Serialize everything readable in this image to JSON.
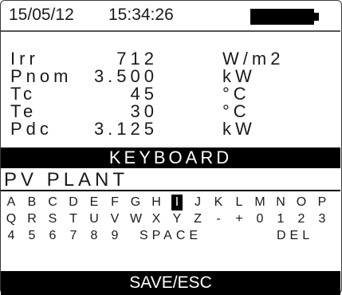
{
  "status_bar": {
    "date": "15/05/12",
    "time": "15:34:26",
    "battery_icon": "battery-full-icon"
  },
  "readings": [
    {
      "label": "Irr",
      "value": "712",
      "unit": "W/m2"
    },
    {
      "label": "Pnom",
      "value": "3.500",
      "unit": "kW"
    },
    {
      "label": "Tc",
      "value": "45",
      "unit": "°C"
    },
    {
      "label": "Te",
      "value": "30",
      "unit": "°C"
    },
    {
      "label": "Pdc",
      "value": "3.125",
      "unit": "kW"
    }
  ],
  "keyboard": {
    "title": "KEYBOARD",
    "field_value": "PV PLANT",
    "rows": [
      [
        "A",
        "B",
        "C",
        "D",
        "E",
        "F",
        "G",
        "H",
        "I",
        "J",
        "K",
        "L",
        "M",
        "N",
        "O",
        "P"
      ],
      [
        "Q",
        "R",
        "S",
        "T",
        "U",
        "V",
        "W",
        "X",
        "Y",
        "Z",
        "-",
        "+",
        "0",
        "1",
        "2",
        "3"
      ],
      [
        "4",
        "5",
        "6",
        "7",
        "8",
        "9",
        "SPACE",
        "DEL"
      ]
    ],
    "selected_key": "I"
  },
  "footer": {
    "save_label": "SAVE/ESC"
  }
}
